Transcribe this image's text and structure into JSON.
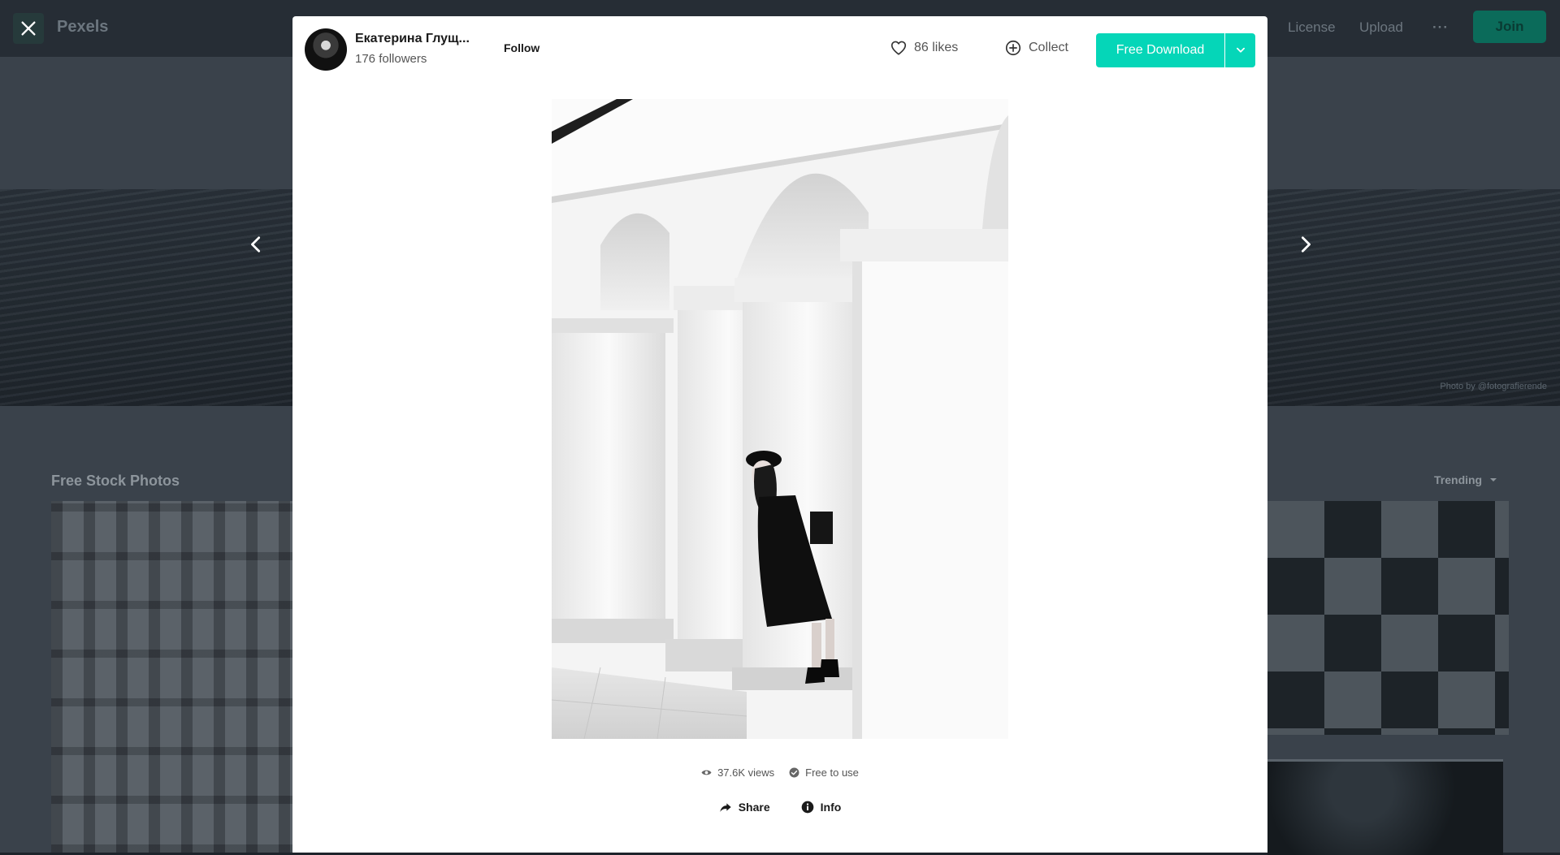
{
  "background": {
    "logo": "Pexels",
    "nav": [
      "License",
      "Upload",
      "···"
    ],
    "join_label": "Join",
    "section_title": "Free Stock Photos",
    "sort_label": "Trending",
    "hero_credit": "Photo by @fotografierende"
  },
  "modal": {
    "author": {
      "name": "Екатерина Глущ...",
      "followers": "176 followers",
      "follow_label": "Follow"
    },
    "likes_label": "86 likes",
    "collect_label": "Collect",
    "download_label": "Free Download",
    "stats": {
      "views": "37.6K views",
      "license": "Free to use"
    },
    "actions": {
      "share": "Share",
      "info": "Info"
    }
  },
  "colors": {
    "accent": "#05d6b8",
    "overlay": "#3a424b",
    "text_dark": "#1a1a1a",
    "text_muted": "#555555"
  },
  "icons": [
    "close-icon",
    "chevron-left-icon",
    "chevron-right-icon",
    "heart-icon",
    "plus-circle-icon",
    "chevron-down-icon",
    "eye-icon",
    "check-circle-icon",
    "share-icon",
    "info-icon"
  ]
}
